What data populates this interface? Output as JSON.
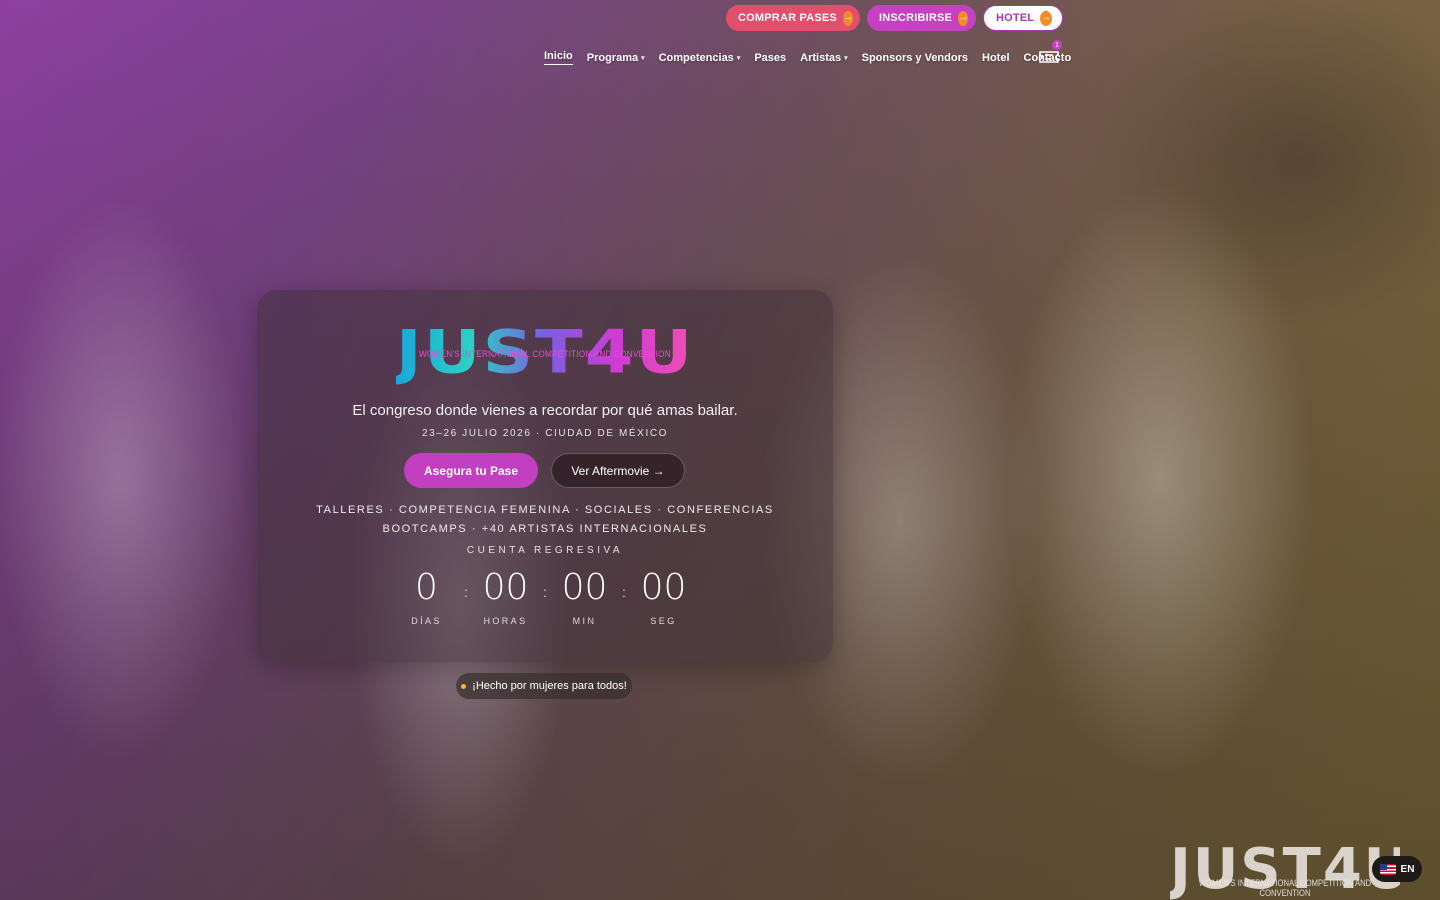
{
  "top_actions": {
    "comprar": "COMPRAR PASES",
    "inscribirse": "INSCRIBIRSE",
    "hotel": "HOTEL"
  },
  "nav": {
    "items": [
      {
        "label": "Inicio",
        "active": true,
        "dropdown": false
      },
      {
        "label": "Programa",
        "dropdown": true
      },
      {
        "label": "Competencias",
        "dropdown": true
      },
      {
        "label": "Pases",
        "dropdown": false
      },
      {
        "label": "Artistas",
        "dropdown": true
      },
      {
        "label": "Sponsors y Vendors",
        "dropdown": false
      },
      {
        "label": "Hotel",
        "dropdown": false
      },
      {
        "label": "Contacto",
        "dropdown": false
      }
    ],
    "cart_count": "1"
  },
  "hero": {
    "logo_text": "JUST4U",
    "logo_subtitle": "WOMEN'S INTERNATIONAL COMPETITION AND CONVENTION",
    "tagline": "El congreso donde vienes a recordar por qué amas bailar.",
    "dates": "23–26 JULIO 2026 · CIUDAD DE MÉXICO",
    "primary_cta": "Asegura tu Pase",
    "secondary_cta": "Ver Aftermovie →",
    "features_line1": "TALLERES · COMPETENCIA FEMENINA · SOCIALES · CONFERENCIAS",
    "features_line2": "BOOTCAMPS · +40 ARTISTAS INTERNACIONALES",
    "countdown_label": "CUENTA REGRESIVA",
    "countdown": {
      "days": "0",
      "days_label": "DÍAS",
      "hours": "00",
      "hours_label": "HORAS",
      "minutes": "00",
      "minutes_label": "MIN",
      "seconds": "00",
      "seconds_label": "SEG"
    }
  },
  "made_by": "¡Hecho por mujeres para todos!",
  "watermark": {
    "word": "JUST4U",
    "subtitle": "WOMEN'S INTERNATIONAL COMPETITION AND CONVENTION"
  },
  "language": {
    "code": "EN"
  },
  "colors": {
    "accent_magenta": "#c640c2",
    "accent_pink": "#e34e6d",
    "arrow_orange": "#f28b2a"
  }
}
